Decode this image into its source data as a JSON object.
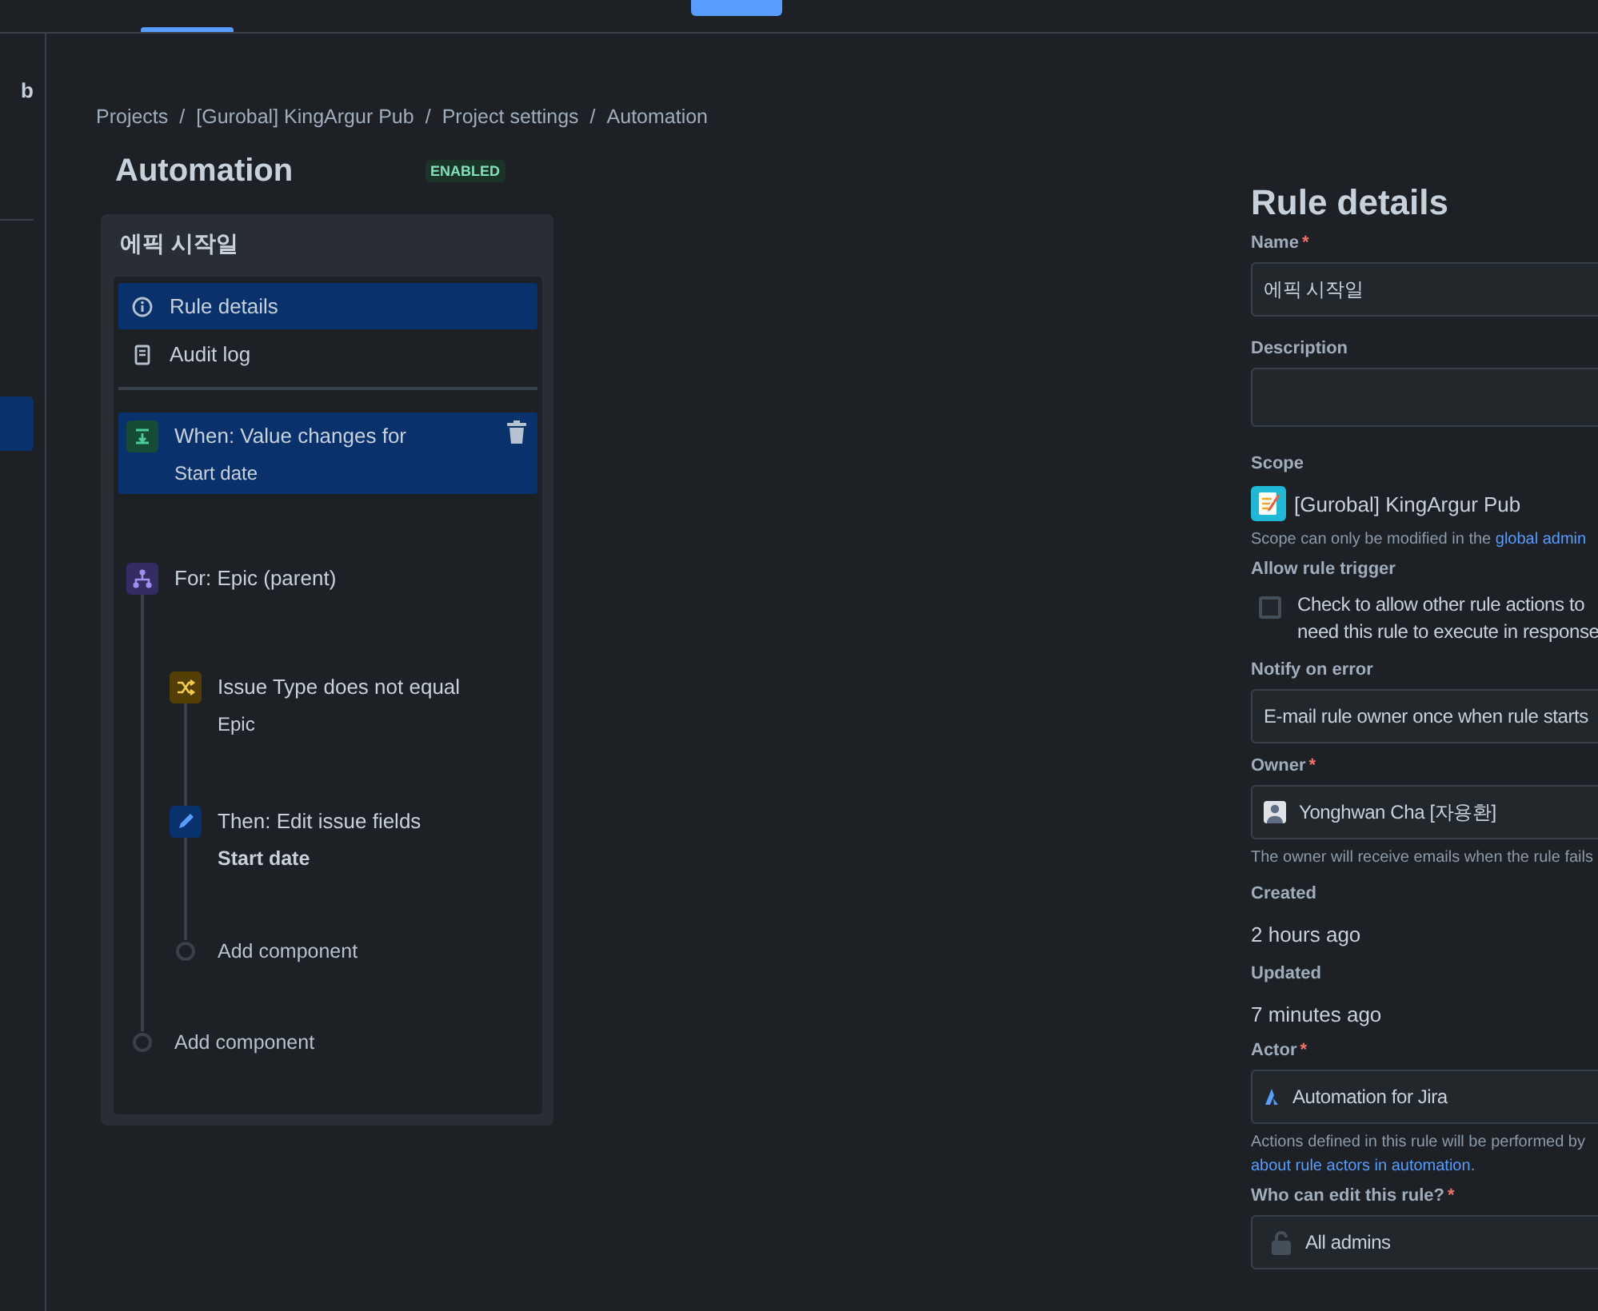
{
  "top_nav": {
    "active_tab_underline": true,
    "create_button": true
  },
  "sidebar": {
    "heading": "b",
    "items": [
      {
        "selected": true
      }
    ]
  },
  "breadcrumbs": [
    "Projects",
    "[Gurobal] KingArgur Pub",
    "Project settings",
    "Automation"
  ],
  "breadcrumb_separator": "/",
  "page_title": "Automation",
  "status_badge": "ENABLED",
  "rule": {
    "name": "에픽 시작일",
    "nav": [
      {
        "kind": "details",
        "label": "Rule details",
        "selected": true
      },
      {
        "kind": "audit",
        "label": "Audit log",
        "selected": false
      }
    ],
    "components": [
      {
        "kind": "trigger",
        "title": "When: Value changes for",
        "detail": "Start date",
        "selected": true,
        "deletable": true
      },
      {
        "kind": "branch",
        "title": "For: Epic (parent)",
        "selected": false,
        "children": [
          {
            "kind": "condition",
            "title": "Issue Type does not equal",
            "detail": "Epic",
            "selected": false
          },
          {
            "kind": "action",
            "title": "Then: Edit issue fields",
            "detail": "Start date",
            "selected": false
          },
          {
            "kind": "add",
            "title": "Add component"
          }
        ]
      },
      {
        "kind": "add",
        "title": "Add component"
      }
    ]
  },
  "details": {
    "title": "Rule details",
    "name": {
      "label": "Name",
      "required_mark": "*",
      "value": "에픽 시작일"
    },
    "description": {
      "label": "Description"
    },
    "scope": {
      "label": "Scope",
      "value": "[Gurobal] KingArgur Pub",
      "help": "Scope can only be modified in the ",
      "help_link": "global admin"
    },
    "allow_trigger": {
      "label": "Allow rule trigger",
      "checked": false,
      "lines": [
        "Check to allow other rule actions to",
        "need this rule to execute in response"
      ]
    },
    "notify": {
      "label": "Notify on error",
      "value": "E-mail rule owner once when rule starts"
    },
    "owner": {
      "label": "Owner",
      "required_mark": "*",
      "value": "Yonghwan Cha [자용환]",
      "help": "The owner will receive emails when the rule fails"
    },
    "created": {
      "label": "Created",
      "value": "2 hours ago"
    },
    "updated": {
      "label": "Updated",
      "value": "7 minutes ago"
    },
    "actor": {
      "label": "Actor",
      "required_mark": "*",
      "value": "Automation for Jira",
      "help": "Actions defined in this rule will be performed by",
      "help_link": "about rule actors in automation",
      "help_end": "."
    },
    "editors": {
      "label": "Who can edit this rule?",
      "required_mark": "*",
      "value": "All admins"
    }
  }
}
